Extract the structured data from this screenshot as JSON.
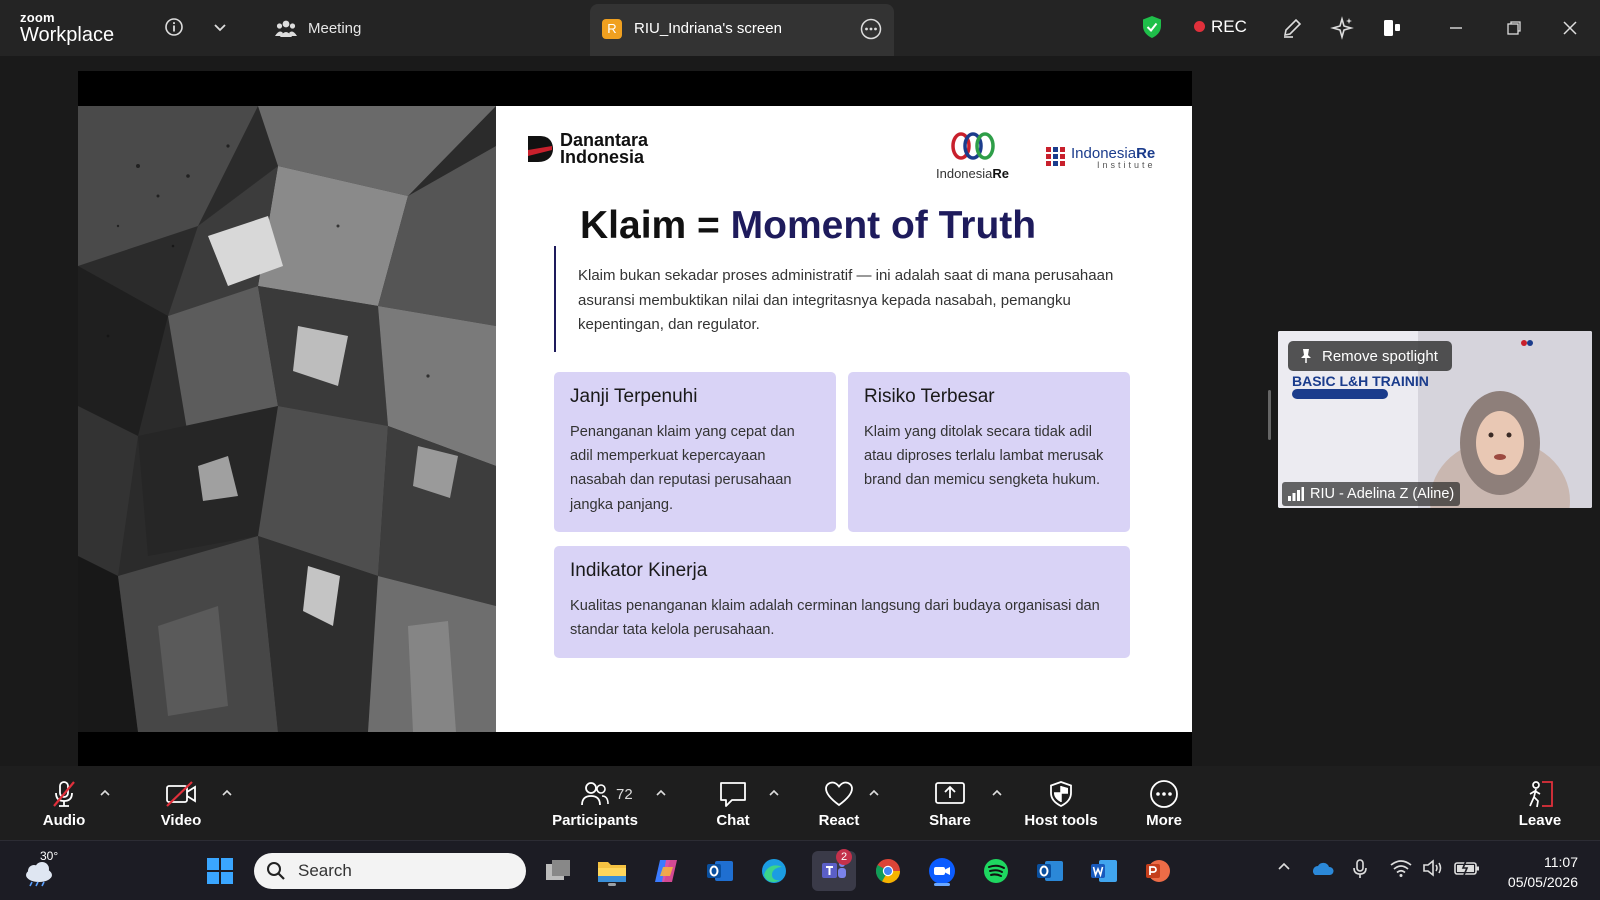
{
  "titlebar": {
    "brand_small": "zoom",
    "brand_big": "Workplace",
    "meeting_label": "Meeting",
    "share_tab_badge": "R",
    "share_tab_label": "RIU_Indriana's screen",
    "rec_label": "REC",
    "colors": {
      "rec_dot": "#e0303b",
      "shield": "#1fbf4a",
      "tab_badge": "#f0a020"
    }
  },
  "slide": {
    "brand_danantara": [
      "Danantara",
      "Indonesia"
    ],
    "brand_indonesiare": [
      "Indonesia",
      "Re"
    ],
    "brand_institute": [
      "Indonesia",
      "Re",
      "Institute"
    ],
    "title_prefix": "Klaim = ",
    "title_accent": "Moment of Truth",
    "intro": "Klaim bukan sekadar proses administratif — ini adalah saat di mana perusahaan asuransi membuktikan nilai dan integritasnya kepada nasabah, pemangku kepentingan, dan regulator.",
    "cards": [
      {
        "title": "Janji Terpenuhi",
        "body": "Penanganan klaim yang cepat dan adil memperkuat kepercayaan nasabah dan reputasi perusahaan jangka panjang."
      },
      {
        "title": "Risiko Terbesar",
        "body": "Klaim yang ditolak secara tidak adil atau diproses terlalu lambat merusak brand dan memicu sengketa hukum."
      },
      {
        "title": "Indikator Kinerja",
        "body": "Kualitas penanganan klaim adalah cerminan langsung dari budaya organisasi dan standar tata kelola perusahaan."
      }
    ],
    "colors": {
      "card_bg": "#d9d3f6",
      "accent": "#1e1b5c"
    }
  },
  "participant_video": {
    "spotlight_label": "Remove spotlight",
    "slide_heading": "BASIC L&H TRAININ",
    "name": "RIU - Adelina Z (Aline)"
  },
  "controls": {
    "audio": "Audio",
    "video": "Video",
    "participants": "Participants",
    "participants_count": "72",
    "chat": "Chat",
    "react": "React",
    "share": "Share",
    "host_tools": "Host tools",
    "more": "More",
    "leave": "Leave"
  },
  "taskbar": {
    "temperature": "30°",
    "search_placeholder": "Search",
    "teams_badge": "2",
    "time": "11:07",
    "date": "05/05/2026"
  }
}
